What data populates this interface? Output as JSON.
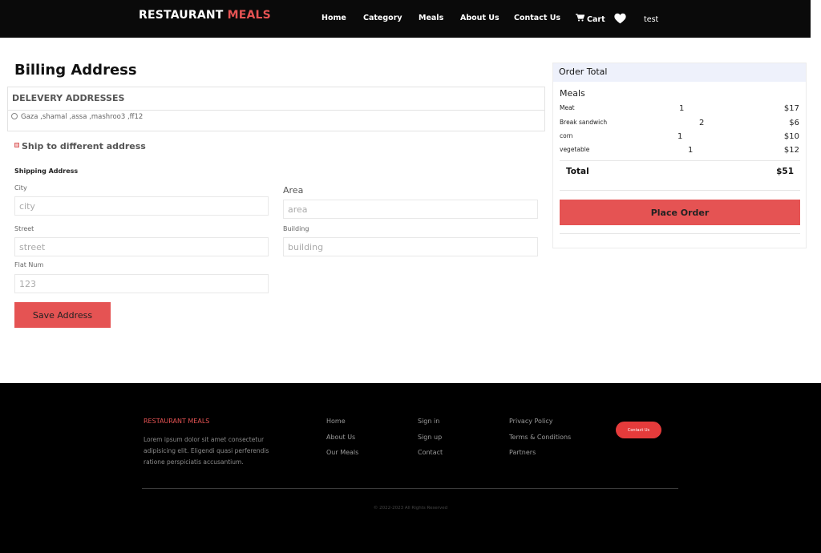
{
  "navbar": {
    "brand_main": "RESTAURANT",
    "brand_accent": "MEALS",
    "links": [
      "Home",
      "Category",
      "Meals",
      "About Us",
      "Contact Us"
    ],
    "cart_label": "Cart",
    "user_label": "test"
  },
  "billing": {
    "title": "Billing Address",
    "addresses_heading": "DELEVERY ADDRESSES",
    "address_option": "Gaza ,shamal ,assa ,mashroo3 ,ff12",
    "ship_different_label": "Ship to different address",
    "shipping_heading": "Shipping Address",
    "fields": {
      "city_label": "City",
      "city_placeholder": "city",
      "area_label": "Area",
      "area_placeholder": "area",
      "street_label": "Street",
      "street_placeholder": "street",
      "building_label": "Building",
      "building_placeholder": "building",
      "flat_label": "Flat Num",
      "flat_placeholder": "123"
    },
    "save_label": "Save Address"
  },
  "order": {
    "header": "Order Total",
    "meals_heading": "Meals",
    "items": [
      {
        "name": "Meat",
        "qty": "1",
        "price": "$17"
      },
      {
        "name": "Break sandwich",
        "qty": "2",
        "price": "$6"
      },
      {
        "name": "corn",
        "qty": "1",
        "price": "$10"
      },
      {
        "name": "vegetable",
        "qty": "1",
        "price": "$12"
      }
    ],
    "total_label": "Total",
    "total_value": "$51",
    "place_order_label": "Place Order"
  },
  "footer": {
    "brand": "RESTAURANT MEALS",
    "description": "Lorem ipsum dolor sit amet consectetur adipisicing elit. Eligendi quasi perferendis ratione perspiciatis accusantium.",
    "col1": [
      "Home",
      "About Us",
      "Our Meals"
    ],
    "col2": [
      "Sign in",
      "Sign up",
      "Contact"
    ],
    "col3": [
      "Privacy Policy",
      "Terms & Conditions",
      "Partners"
    ],
    "contact_button": "Contact Us",
    "copyright": "© 2022-2023 All Rights Reserved"
  },
  "colors": {
    "accent": "#e55353",
    "navbar_bg": "#0a0a0a",
    "footer_bg": "#000000",
    "order_header_bg": "#eef1fb"
  }
}
